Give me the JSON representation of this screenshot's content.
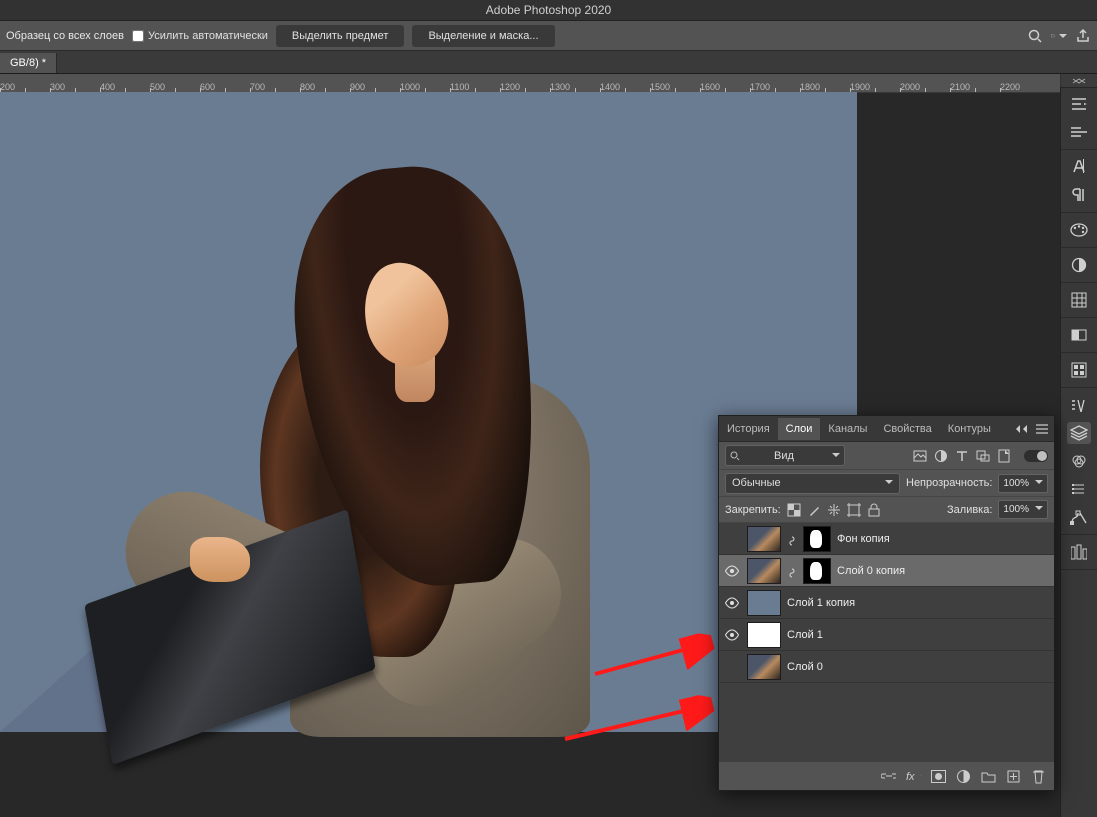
{
  "app_title": "Adobe Photoshop 2020",
  "options_bar": {
    "sample_label": "Образец со всех слоев",
    "enhance_auto": "Усилить автоматически",
    "btn_select_subject": "Выделить предмет",
    "btn_select_mask": "Выделение и маска..."
  },
  "document_tab": "GB/8) *",
  "ruler_start": 200,
  "ruler_step": 50,
  "ruler_label_step": 100,
  "ruler_end": 2200,
  "panel": {
    "tabs": {
      "history": "История",
      "layers": "Слои",
      "channels": "Каналы",
      "props": "Свойства",
      "paths": "Контуры"
    },
    "filter_kind": "Вид",
    "blend_mode": "Обычные",
    "opacity_label": "Непрозрачность:",
    "opacity_value": "100%",
    "fill_label": "Заливка:",
    "fill_value": "100%",
    "lock_label": "Закрепить:"
  },
  "layers": [
    {
      "visible": false,
      "thumb": "img",
      "has_mask": true,
      "name": "Фон копия"
    },
    {
      "visible": true,
      "thumb": "img",
      "has_mask": true,
      "name": "Слой 0 копия",
      "selected": true
    },
    {
      "visible": true,
      "thumb": "blue",
      "has_mask": false,
      "name": "Слой 1 копия"
    },
    {
      "visible": true,
      "thumb": "white",
      "has_mask": false,
      "name": "Слой 1"
    },
    {
      "visible": false,
      "thumb": "img",
      "has_mask": false,
      "name": "Слой 0"
    }
  ]
}
